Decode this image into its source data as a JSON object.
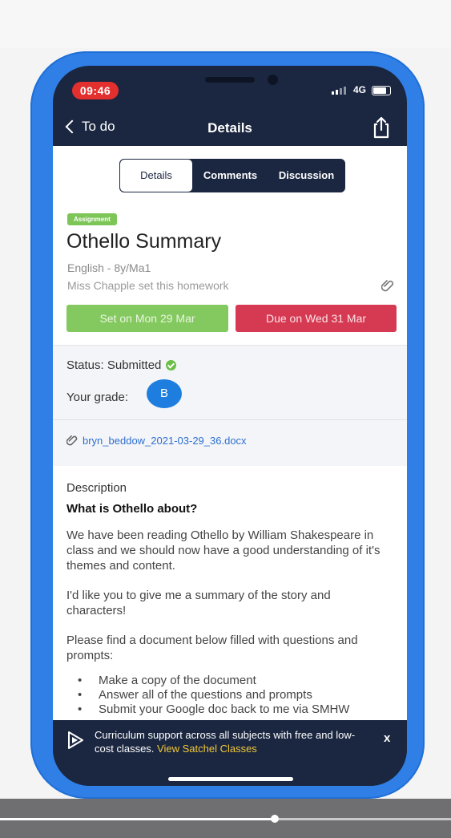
{
  "status_bar": {
    "time": "09:46",
    "network": "4G"
  },
  "nav": {
    "back_label": "To do",
    "title": "Details"
  },
  "tabs": [
    {
      "label": "Details",
      "active": true
    },
    {
      "label": "Comments",
      "active": false
    },
    {
      "label": "Discussion",
      "active": false
    }
  ],
  "assignment": {
    "tag": "Assignment",
    "title": "Othello Summary",
    "subject": "English - 8y/Ma1",
    "teacher": "Miss Chapple set this homework",
    "set_date": "Set on Mon 29 Mar",
    "due_date": "Due on Wed 31 Mar"
  },
  "status": {
    "text": "Status: Submitted",
    "grade_label": "Your grade:",
    "grade": "B",
    "attachment": "bryn_beddow_2021-03-29_36.docx"
  },
  "description": {
    "heading": "Description",
    "subheading": "What is Othello about?",
    "paragraphs": [
      "We have been reading Othello by William Shakespeare in class and we should now have a good understanding of it's themes and content.",
      "I'd like you to give me a summary of the story and characters!",
      "Please find a document below filled with questions and prompts:"
    ],
    "bullets": [
      "Make a copy of the document",
      "Answer all of the questions and prompts",
      "Submit your Google doc back to me via SMHW"
    ]
  },
  "banner": {
    "text": "Curriculum support across all subjects with free and low-cost classes.",
    "link": "View Satchel Classes",
    "close": "x"
  },
  "video": {
    "progress": 0.61
  },
  "colors": {
    "case": "#2f7fe6",
    "navy": "#1b2740",
    "tag_green": "#7cc556",
    "set_green": "#84c95f",
    "due_red": "#d63a53",
    "grade_blue": "#1e7ee0",
    "link_blue": "#2e6fd0",
    "banner_link": "#f1c83a",
    "time_red": "#e3302f"
  }
}
